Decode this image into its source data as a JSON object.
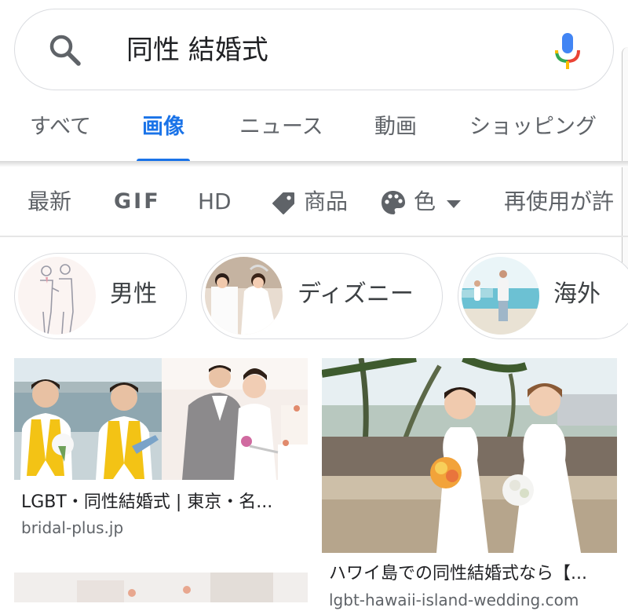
{
  "search": {
    "query": "同性 結婚式"
  },
  "tabs": [
    {
      "label": "すべて",
      "active": false
    },
    {
      "label": "画像",
      "active": true
    },
    {
      "label": "ニュース",
      "active": false
    },
    {
      "label": "動画",
      "active": false
    },
    {
      "label": "ショッピング",
      "active": false
    }
  ],
  "filters": {
    "latest": "最新",
    "gif": "GIF",
    "hd": "HD",
    "products": "商品",
    "color": "色",
    "reuse": "再使用が許"
  },
  "chips": [
    {
      "label": "男性"
    },
    {
      "label": "ディズニー"
    },
    {
      "label": "海外"
    }
  ],
  "results": [
    {
      "title": "LGBT・同性結婚式 | 東京・名...",
      "source": "bridal-plus.jp"
    },
    {
      "title": "ハワイ島での同性結婚式なら【...",
      "source": "lgbt-hawaii-island-wedding.com"
    }
  ],
  "colors": {
    "accent": "#1a73e8",
    "google_blue": "#4285f4",
    "google_red": "#ea4335",
    "google_yellow": "#fbbc04",
    "google_green": "#34a853"
  }
}
